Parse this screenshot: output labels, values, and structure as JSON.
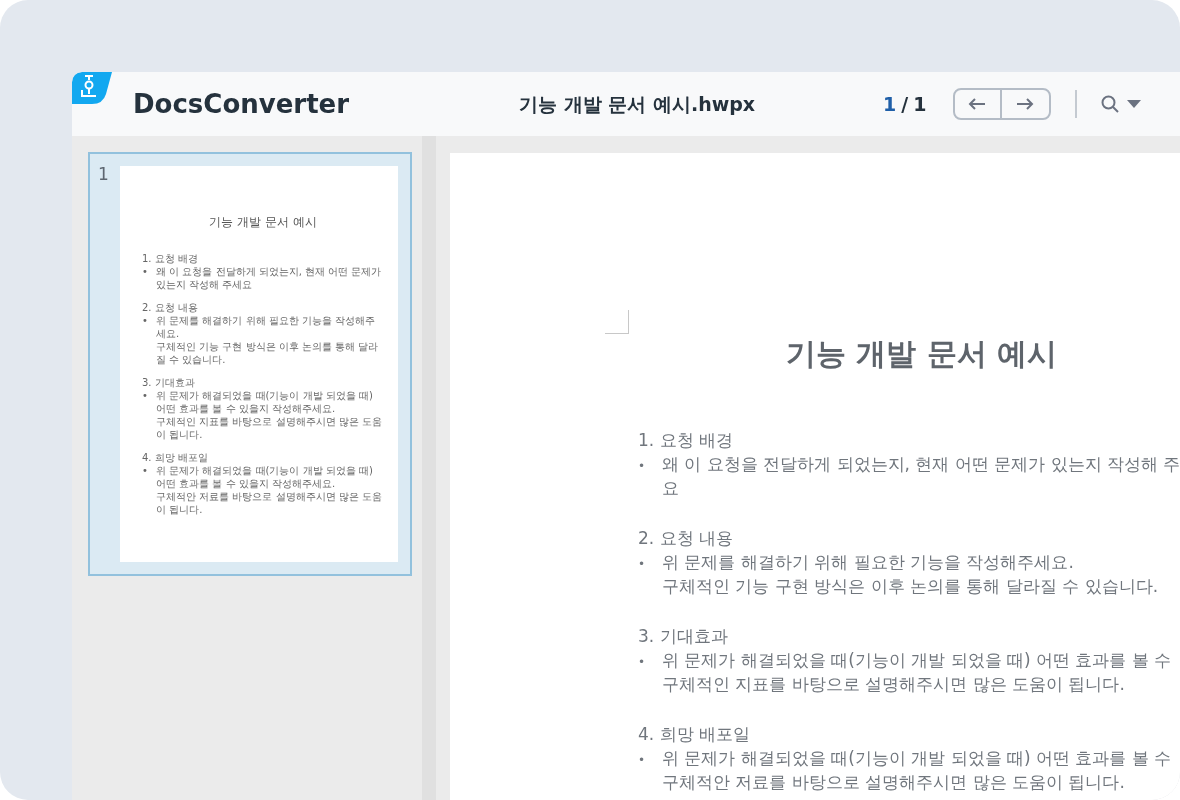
{
  "header": {
    "app_name": "DocsConverter",
    "file_title": "기능 개발 문서 예시.hwpx",
    "current_page": "1",
    "page_separator": "/",
    "total_pages": "1"
  },
  "thumbnails": [
    {
      "number": "1",
      "selected": true,
      "title": "기능 개발 문서 예시",
      "sections": [
        {
          "heading": "1. 요청 배경",
          "bullet": "•",
          "lines": [
            "왜 이 요청을 전달하게 되었는지, 현재 어떤 문제가 있는지 작성해 주세요"
          ]
        },
        {
          "heading": "2. 요청 내용",
          "bullet": "•",
          "lines": [
            "위 문제를 해결하기 위해 필요한 기능을 작성해주세요.",
            "구체적인 기능 구현 방식은 이후 논의를 통해 달라질 수 있습니다."
          ]
        },
        {
          "heading": "3. 기대효과",
          "bullet": "•",
          "lines": [
            "위 문제가 해결되었을 때(기능이 개발 되었을 때) 어떤 효과를 볼 수 있을지 작성해주세요.",
            "구체적인 지표를 바탕으로 설명해주시면 많은 도움이 됩니다."
          ]
        },
        {
          "heading": "4. 희망 배포일",
          "bullet": "•",
          "lines": [
            "위 문제가 해결되었을 때(기능이 개발 되었을 때) 어떤 효과를 볼 수 있을지 작성해주세요.",
            "구체적안 저료를 바탕으로 설명해주시면 많은 도움이 됩니다."
          ]
        }
      ]
    }
  ],
  "document": {
    "title": "기능 개발 문서 예시",
    "sections": [
      {
        "heading": "1. 요청 배경",
        "bullet": "•",
        "lines": [
          "왜 이 요청을 전달하게 되었는지, 현재 어떤 문제가 있는지 작성해 주",
          "요"
        ]
      },
      {
        "heading": "2. 요청 내용",
        "bullet": "•",
        "lines": [
          "위 문제를 해결하기 위해 필요한 기능을 작성해주세요.",
          "구체적인 기능 구현 방식은 이후 논의를 통해 달라질 수 있습니다."
        ]
      },
      {
        "heading": "3. 기대효과",
        "bullet": "•",
        "lines": [
          "위 문제가 해결되었을 때(기능이 개발 되었을 때) 어떤 효과를 볼 수",
          "구체적인 지표를 바탕으로 설명해주시면 많은 도움이 됩니다."
        ]
      },
      {
        "heading": "4. 희망 배포일",
        "bullet": "•",
        "lines": [
          "위 문제가 해결되었을 때(기능이 개발 되었을 때) 어떤 효과를 볼 수",
          "구체적안 저료를 바탕으로 설명해주시면 많은 도움이 됩니다."
        ]
      }
    ]
  }
}
